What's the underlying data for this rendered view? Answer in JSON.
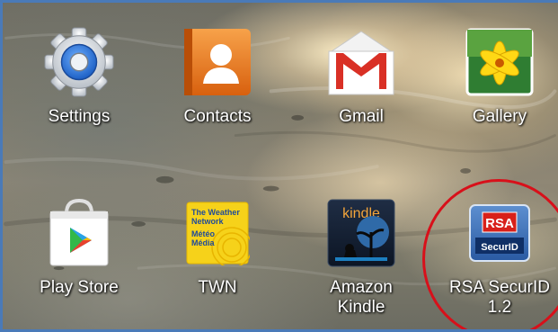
{
  "home_screen": {
    "apps": [
      {
        "id": "settings",
        "label": "Settings",
        "icon": "gear-icon"
      },
      {
        "id": "contacts",
        "label": "Contacts",
        "icon": "person-icon"
      },
      {
        "id": "gmail",
        "label": "Gmail",
        "icon": "envelope-icon"
      },
      {
        "id": "gallery",
        "label": "Gallery",
        "icon": "flower-icon"
      },
      {
        "id": "play-store",
        "label": "Play Store",
        "icon": "shopping-bag-icon"
      },
      {
        "id": "twn",
        "label": "TWN",
        "icon": "weather-network-icon",
        "icon_text": {
          "line1": "The Weather",
          "line2": "Network",
          "line3": "Météo",
          "line4": "Média"
        }
      },
      {
        "id": "amazon-kindle",
        "label_line1": "Amazon",
        "label_line2": "Kindle",
        "icon": "kindle-icon",
        "icon_text": "kindle"
      },
      {
        "id": "rsa-securid",
        "label_line1": "RSA SecurID",
        "label_line2": "1.2",
        "icon": "rsa-securid-icon",
        "icon_text": {
          "brand": "RSA",
          "product": "SecurID"
        }
      }
    ],
    "highlight_color": "#d8101a"
  }
}
